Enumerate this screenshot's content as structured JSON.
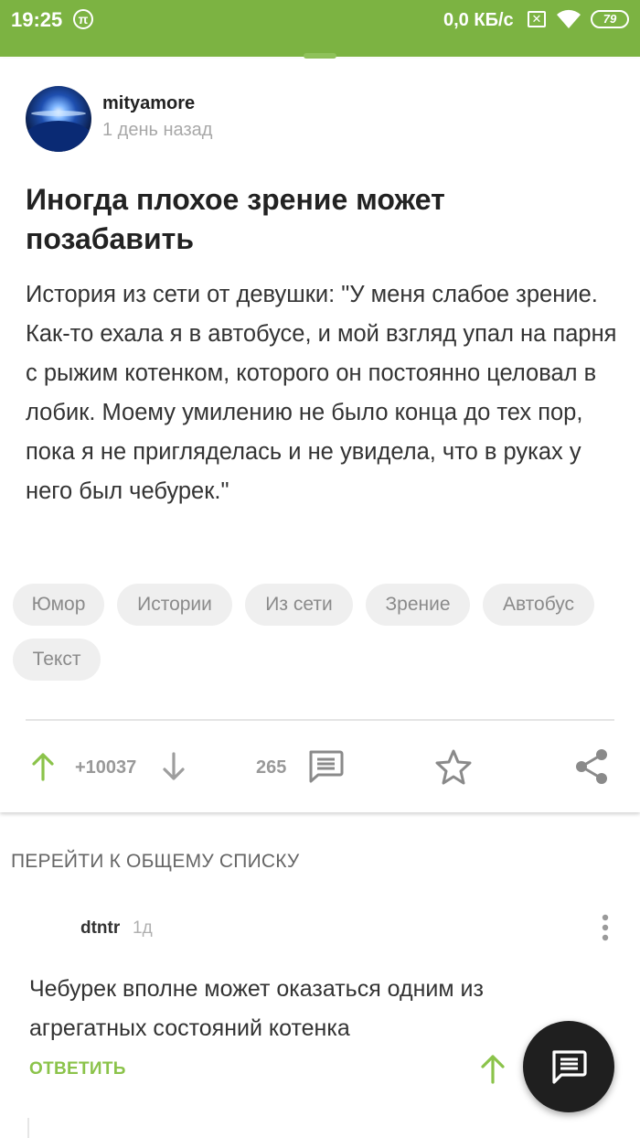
{
  "status_bar": {
    "time": "19:25",
    "pi_glyph": "π",
    "net_speed": "0,0 КБ/с",
    "sim_glyph": "✕",
    "battery": "79"
  },
  "post": {
    "author": "mityamore",
    "time": "1 день назад",
    "title": "Иногда плохое зрение может позабавить",
    "body": "История из сети от девушки: \"У меня слабое зрение. Как-то ехала я в автобусе, и мой взгляд упал на парня с рыжим котенком, которого он постоянно целовал в лобик. Моему умилению не было конца до тех пор, пока я не пригляделась и не увидела, что в руках у него был чебурек.\"",
    "tags": [
      "Юмор",
      "Истории",
      "Из сети",
      "Зрение",
      "Автобус",
      "Текст"
    ],
    "rating": "+10037",
    "comments_count": "265"
  },
  "goto_all": "ПЕРЕЙТИ К ОБЩЕМУ СПИСКУ",
  "comment": {
    "author": "dtntr",
    "time": "1д",
    "text": "Чебурек вполне может оказаться одним из агрегатных состояний котенка",
    "reply_label": "ОТВЕТИТЬ"
  },
  "colors": {
    "accent": "#7cb342",
    "upvote": "#8bc34a",
    "fab": "#1f1f1f"
  },
  "icons": {
    "upvote": "arrow-up-icon",
    "downvote": "arrow-down-icon",
    "comments": "comment-icon",
    "save": "star-icon",
    "share": "share-icon",
    "more": "more-vertical-icon",
    "fab": "write-comment-icon"
  }
}
